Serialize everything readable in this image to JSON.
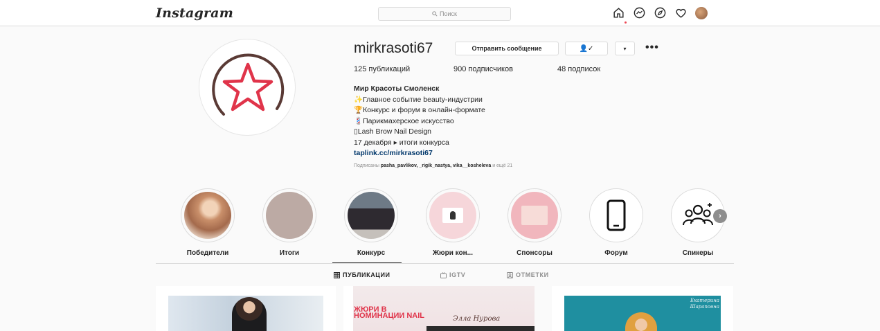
{
  "header": {
    "logo": "Instagram",
    "search_placeholder": "Поиск"
  },
  "profile": {
    "username": "mirkrasoti67",
    "message_button": "Отправить сообщение",
    "follow_glyph": "👤✓",
    "more_glyph": "▾",
    "options_glyph": "•••",
    "stats": {
      "posts": "125 публикаций",
      "followers": "900 подписчиков",
      "following": "48 подписок"
    },
    "bio": {
      "name": "Мир Красоты Смоленск",
      "lines": [
        "✨Главное событие beauty-индустрии",
        "🏆Конкурс и форум в онлайн-формате",
        "💈Парикмахерское искусство",
        "▯Lash Brow Nail Design",
        "17 декабря ▸ итоги конкурса"
      ],
      "link": "taplink.cc/mirkrasoti67"
    },
    "followed_by": {
      "prefix": "Подписаны",
      "users": "pasha_pavlikov, _rigik_nastya, vika__kosheleva",
      "suffix": "и ещё 21"
    }
  },
  "highlights": [
    {
      "label": "Победители"
    },
    {
      "label": "Итоги"
    },
    {
      "label": "Конкурс"
    },
    {
      "label": "Жюри кон..."
    },
    {
      "label": "Спонсоры"
    },
    {
      "label": "Форум"
    },
    {
      "label": "Спикеры"
    }
  ],
  "tabs": [
    {
      "label": "ПУБЛИКАЦИИ",
      "icon": "grid-icon"
    },
    {
      "label": "IGTV",
      "icon": "tv-icon"
    },
    {
      "label": "ОТМЕТКИ",
      "icon": "tag-icon"
    }
  ],
  "posts": {
    "post2_title": "ЖЮРИ В НОМИНАЦИИ NAIL",
    "post2_signature": "Элла Нурова",
    "post3_signature": "Екатерина Шараповна"
  },
  "colors": {
    "accent_red": "#e0344a",
    "link_blue": "#00376b",
    "border": "#dbdbdb"
  }
}
